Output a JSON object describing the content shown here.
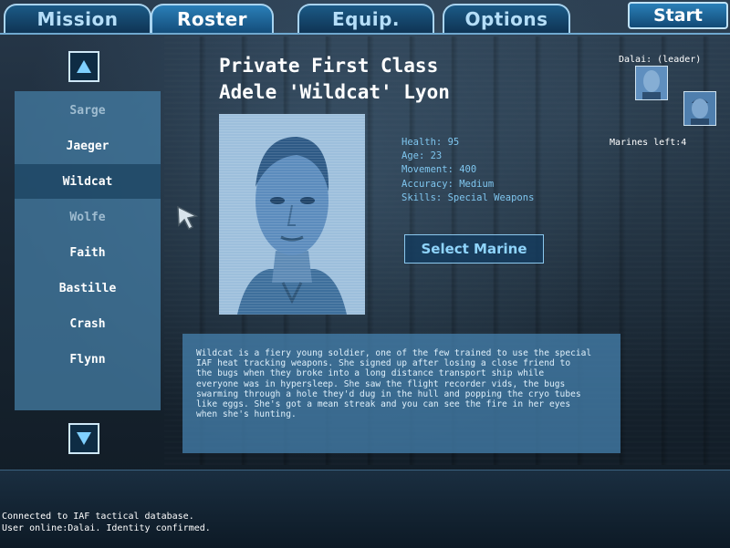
{
  "tabs": [
    {
      "label": "Mission"
    },
    {
      "label": "Roster"
    },
    {
      "label": "Equip."
    },
    {
      "label": "Options"
    }
  ],
  "active_tab": "Roster",
  "start_label": "Start",
  "roster": {
    "items": [
      {
        "name": "Sarge",
        "state": "dimmed"
      },
      {
        "name": "Jaeger",
        "state": "normal"
      },
      {
        "name": "Wildcat",
        "state": "selected"
      },
      {
        "name": "Wolfe",
        "state": "dimmed"
      },
      {
        "name": "Faith",
        "state": "normal"
      },
      {
        "name": "Bastille",
        "state": "normal"
      },
      {
        "name": "Crash",
        "state": "normal"
      },
      {
        "name": "Flynn",
        "state": "normal"
      }
    ],
    "scroll_up_icon": "triangle-up-icon",
    "scroll_down_icon": "triangle-down-icon"
  },
  "marine": {
    "rank": "Private First Class",
    "name": "Adele 'Wildcat' Lyon",
    "stats": {
      "health": "Health: 95",
      "age": "Age: 23",
      "movement": "Movement: 400",
      "accuracy": "Accuracy: Medium",
      "skills": "Skills: Special Weapons"
    },
    "select_label": "Select Marine",
    "bio_lines": [
      "Wildcat is a fiery young soldier, one of the few trained to use the special",
      "IAF heat tracking weapons.  She signed up after losing a close friend to",
      "the bugs when they broke into a long distance transport ship while",
      "everyone was in hypersleep.  She saw the flight recorder vids, the bugs",
      "swarming through a hole they'd dug in the hull and popping the cryo tubes",
      "like eggs.  She's got a mean streak and you can see the fire in her eyes",
      "when she's hunting."
    ]
  },
  "squad": {
    "leader_label": "Dalai: (leader)",
    "marines_left": "Marines left:4"
  },
  "status": {
    "line1": "Connected to IAF tactical database.",
    "line2": "User online:Dalai.  Identity confirmed."
  },
  "colors": {
    "tab_fill": "#1b5a86",
    "tab_border": "#a9d4f0",
    "list_panel": "#427aa0",
    "stat_text": "#7fc6ef",
    "bio_panel": "#4682af"
  }
}
